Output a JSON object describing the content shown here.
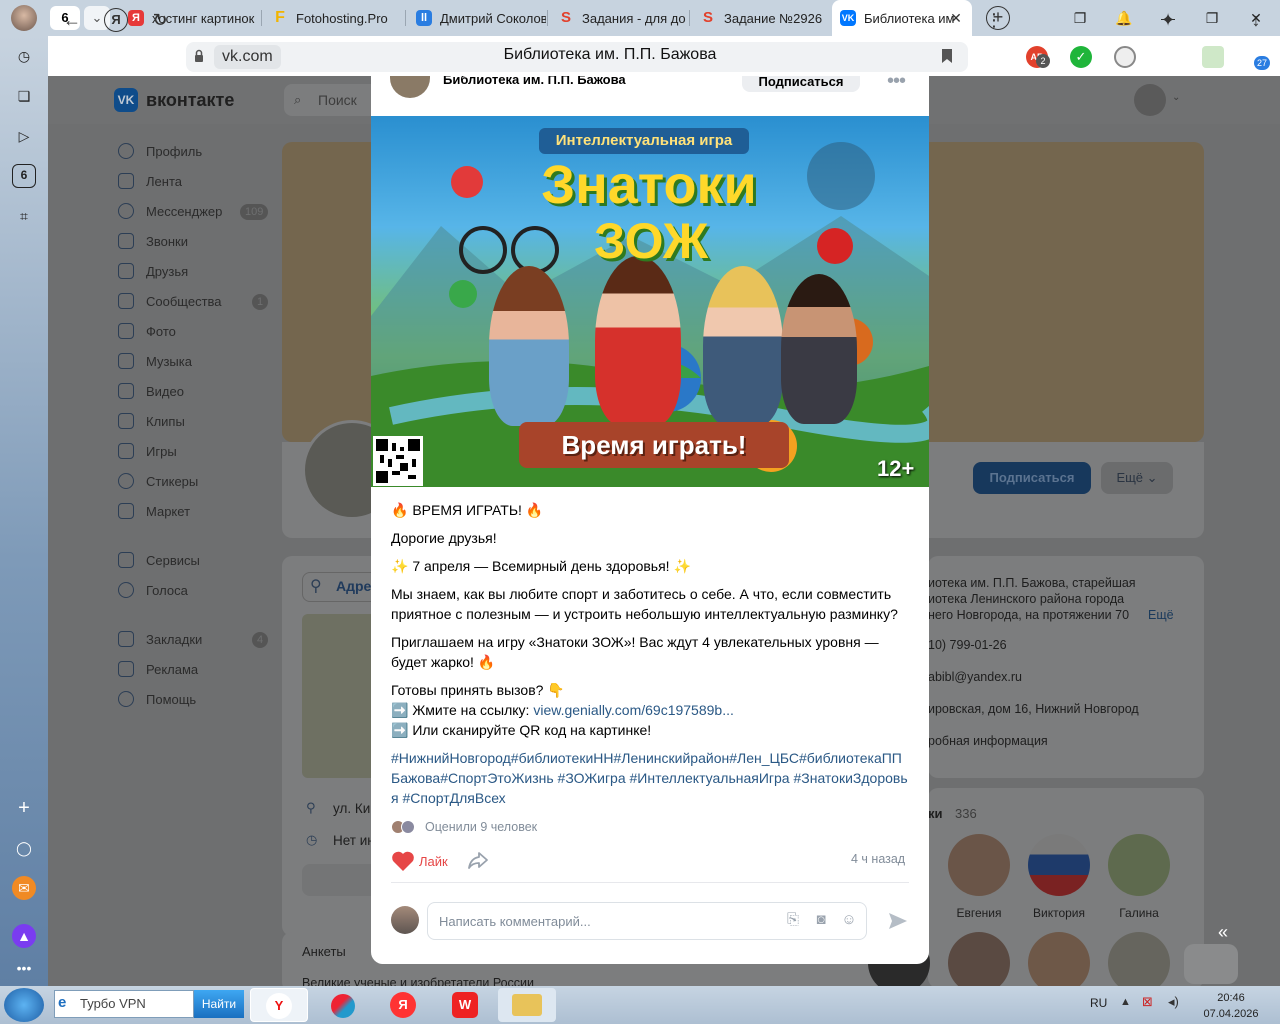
{
  "browser": {
    "tab_count": "6",
    "tabs": [
      {
        "label": "хостинг картинок",
        "color": "#e63939"
      },
      {
        "label": "Fotohosting.Pro",
        "color": "#f2b400"
      },
      {
        "label": "Дмитрий Соколов",
        "color": "#2a7de1"
      },
      {
        "label": "Задания - для до",
        "color": "#e2412c"
      },
      {
        "label": "Задание №2926",
        "color": "#e2412c"
      },
      {
        "label": "Библиотека им. П.П.",
        "color": "#0077ff"
      }
    ],
    "url_domain": "vk.com",
    "page_title": "Библиотека им. П.П. Бажова",
    "sidebar_badge": "6",
    "ext_badge_1": "2",
    "ext_badge_2": "27"
  },
  "vk": {
    "logo_text": "вконтакте",
    "search_placeholder": "Поиск",
    "nav": [
      {
        "label": "Профиль"
      },
      {
        "label": "Лента"
      },
      {
        "label": "Мессенджер",
        "badge": "109"
      },
      {
        "label": "Звонки"
      },
      {
        "label": "Друзья"
      },
      {
        "label": "Сообщества",
        "badge": "1"
      },
      {
        "label": "Фото"
      },
      {
        "label": "Музыка"
      },
      {
        "label": "Видео"
      },
      {
        "label": "Клипы"
      },
      {
        "label": "Игры"
      },
      {
        "label": "Стикеры"
      },
      {
        "label": "Маркет"
      },
      {
        "label": "Сервисы"
      },
      {
        "label": "Голоса"
      },
      {
        "label": "Закладки",
        "badge": "4"
      },
      {
        "label": "Реклама"
      },
      {
        "label": "Помощь"
      }
    ],
    "page_subscribe": "Подписаться",
    "page_more": "Ещё",
    "info": {
      "line1": "иотека им. П.П. Бажова, старейшая",
      "line2": "иотека Ленинского района города",
      "line3": "него Новгорода, на протяжении 70",
      "more": "Ещё",
      "phone": "10) 799-01-26",
      "email": "abibl@yandex.ru",
      "address": "ировская, дом 16, Нижний Новгород",
      "details": "робная информация"
    },
    "friends_label": "ки",
    "friends_count": "336",
    "friends": [
      "Евгения",
      "Виктория",
      "Галина"
    ],
    "map_tab": "Адре",
    "address_short": "ул. Ки",
    "no_info": "Нет ин",
    "ankety": "Анкеты",
    "ankety_sub": "Великие ученые и изобретатели России"
  },
  "post": {
    "author": "Библиотека им. П.П. Бажова",
    "subscribe": "Подписаться",
    "poster": {
      "subtitle": "Интеллектуальная игра",
      "title1": "Знатоки",
      "title2": "ЗОЖ",
      "ribbon": "Время играть!",
      "age": "12+"
    },
    "text": {
      "p1": "🔥 ВРЕМЯ ИГРАТЬ! 🔥",
      "p2": "Дорогие друзья!",
      "p3": "✨ 7 апреля — Всемирный день здоровья! ✨",
      "p4": "Мы знаем, как вы любите спорт и заботитесь о себе. А что, если совместить приятное с полезным — и устроить небольшую интеллектуальную разминку?",
      "p5": "Приглашаем на игру «Знатоки ЗОЖ»! Вас ждут 4 увлекательных уровня — будет жарко! 🔥",
      "p6": "Готовы принять вызов? 👇",
      "p7a": "➡️ Жмите на ссылку: ",
      "p7_link": "view.genially.com/69c197589b...",
      "p8": "➡️ Или сканируйте QR код на картинке!",
      "tags": "#НижнийНовгород#библиотекиНН#Ленинскийрайон#Лен_ЦБС#библиотекаППБажова#СпортЭтоЖизнь #ЗОЖигра #ИнтеллектуальнаяИгра #ЗнатокиЗдоровья #СпортДляВсех"
    },
    "rated": "Оценили 9 человек",
    "like": "Лайк",
    "time_ago": "4 ч назад",
    "comment_placeholder": "Написать комментарий..."
  },
  "taskbar": {
    "search_value": "Турбо VPN",
    "search_button": "Найти",
    "lang": "RU",
    "time": "20:46",
    "date": "07.04.2026"
  }
}
